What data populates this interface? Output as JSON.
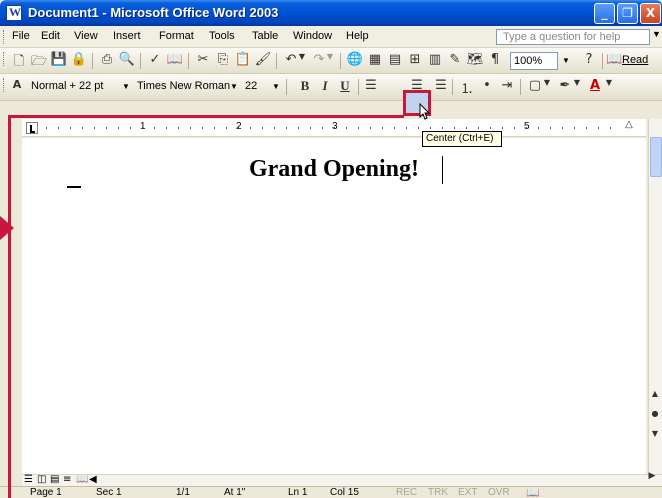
{
  "window": {
    "title": "Document1 - Microsoft Office Word 2003",
    "minimize": "_",
    "restore": "❐",
    "close": "X"
  },
  "menu": {
    "items": [
      "File",
      "Edit",
      "View",
      "Insert",
      "Format",
      "Tools",
      "Table",
      "Window",
      "Help"
    ],
    "help_placeholder": "Type a question for help"
  },
  "standard_toolbar": {
    "zoom": "100%",
    "read_label": "Read"
  },
  "formatting_toolbar": {
    "style": "Normal + 22 pt",
    "font": "Times New Roman",
    "size": "22",
    "bold": "B",
    "italic": "I",
    "underline": "U",
    "tooltip": "Center (Ctrl+E)"
  },
  "ruler": {
    "numbers": [
      "1",
      "2",
      "3",
      "5"
    ]
  },
  "document": {
    "heading": "Grand Opening!"
  },
  "status": {
    "page": "Page 1",
    "sec": "Sec 1",
    "pages": "1/1",
    "at": "At 1\"",
    "ln": "Ln 1",
    "col": "Col 15",
    "rec": "REC",
    "trk": "TRK",
    "ext": "EXT",
    "ovr": "OVR"
  },
  "colors": {
    "callout": "#c8173b",
    "titlebar": "#0052d6"
  }
}
